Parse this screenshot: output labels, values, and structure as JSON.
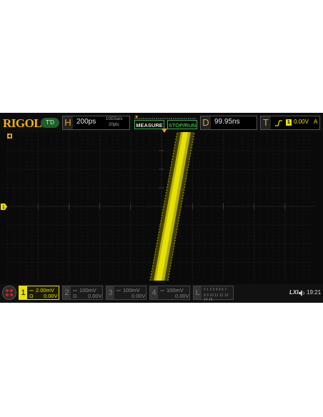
{
  "brand": "RIGOL",
  "mode_button": "T'D",
  "horizontal": {
    "letter": "H",
    "timebase": "200ps",
    "rate": "10GSa/s",
    "points": "20pts"
  },
  "buttons": {
    "measure": "MEASURE",
    "stop_run": "STOP/RUN"
  },
  "delay": {
    "letter": "D",
    "value": "99.95ns"
  },
  "trigger": {
    "letter": "T",
    "channel": "1",
    "level": "0.00V",
    "mode": "A"
  },
  "channels": [
    {
      "num": "1",
      "scale": "2.00mV",
      "coupling": "Ω",
      "offset": "0.00V",
      "active": true
    },
    {
      "num": "2",
      "scale": "100mV",
      "coupling": "Ω",
      "offset": "0.00V",
      "active": false
    },
    {
      "num": "3",
      "scale": "100mV",
      "coupling": "",
      "offset": "0.00V",
      "active": false
    },
    {
      "num": "4",
      "scale": "100mV",
      "coupling": "",
      "offset": "0.00V",
      "active": false
    }
  ],
  "logic": {
    "letter": "L",
    "row1": "0 1 2 3  4 5 6 7",
    "row2": "8 9 10 11 12 13 14 15"
  },
  "status": {
    "lxi": "LXI",
    "time": "19:21"
  },
  "colors": {
    "ch1": "#e8e200",
    "accent": "#e8a020",
    "green": "#3fb04a"
  }
}
